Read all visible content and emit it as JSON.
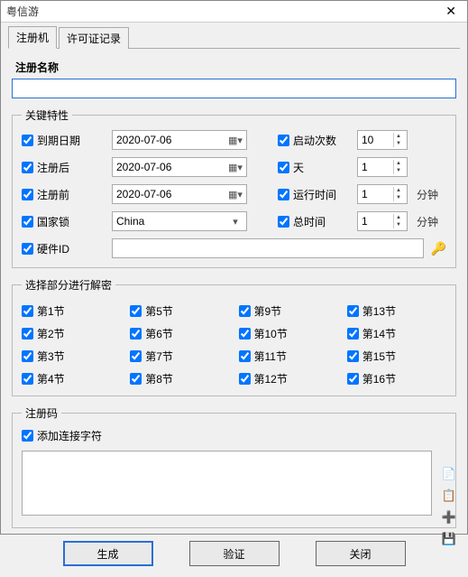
{
  "window": {
    "title": "粤信游"
  },
  "tabs": {
    "register": "注册机",
    "license_log": "许可证记录"
  },
  "reg_name_label": "注册名称",
  "reg_name_value": "",
  "key_props": {
    "legend": "关键特性",
    "expire_date": {
      "label": "到期日期",
      "value": "2020-07-06"
    },
    "register_after": {
      "label": "注册后",
      "value": "2020-07-06"
    },
    "register_before": {
      "label": "注册前",
      "value": "2020-07-06"
    },
    "country_lock": {
      "label": "国家锁",
      "value": "China"
    },
    "hardware_id": {
      "label": "硬件ID",
      "value": ""
    },
    "launch_count": {
      "label": "启动次数",
      "value": "10"
    },
    "days": {
      "label": "天",
      "value": "1"
    },
    "run_time": {
      "label": "运行时间",
      "value": "1",
      "unit": "分钟"
    },
    "total_time": {
      "label": "总时间",
      "value": "1",
      "unit": "分钟"
    }
  },
  "sections": {
    "legend": "选择部分进行解密",
    "items": [
      "第1节",
      "第2节",
      "第3节",
      "第4节",
      "第5节",
      "第6节",
      "第7节",
      "第8节",
      "第9节",
      "第10节",
      "第11节",
      "第12节",
      "第13节",
      "第14节",
      "第15节",
      "第16节"
    ]
  },
  "regcode": {
    "legend": "注册码",
    "add_join_chars": "添加连接字符",
    "value": ""
  },
  "buttons": {
    "generate": "生成",
    "verify": "验证",
    "close": "关闭"
  },
  "icons": {
    "copy": "copy-icon",
    "paste": "paste-icon",
    "add": "add-icon",
    "save": "save-icon",
    "key": "key-icon"
  }
}
